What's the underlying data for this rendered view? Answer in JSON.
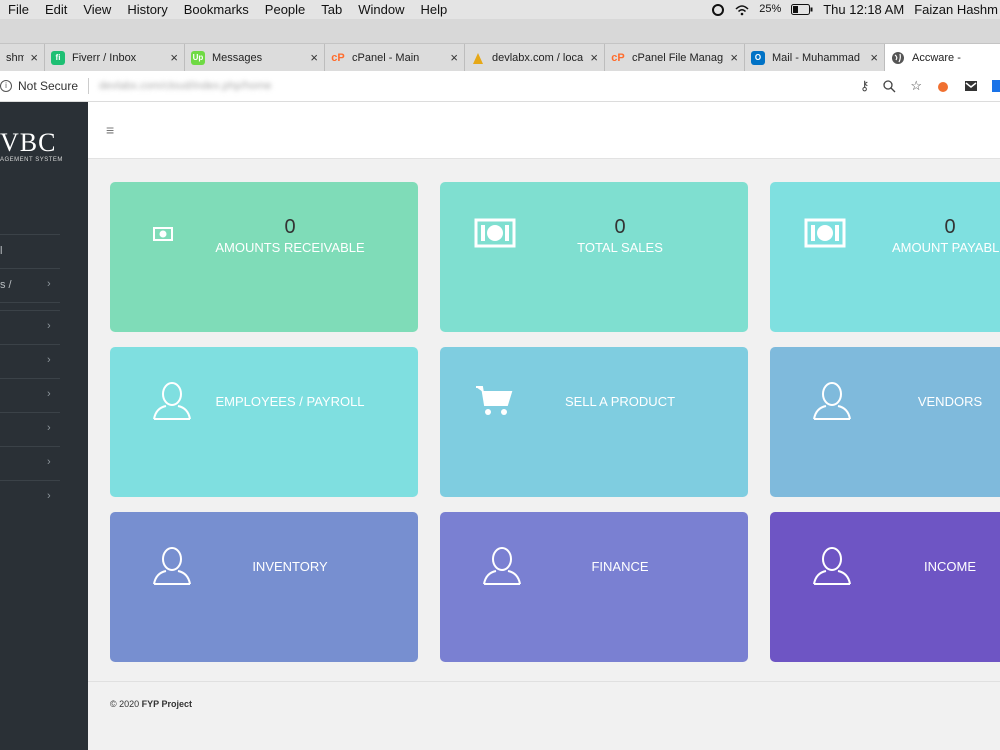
{
  "menubar": {
    "items": [
      "File",
      "Edit",
      "View",
      "History",
      "Bookmarks",
      "People",
      "Tab",
      "Window",
      "Help"
    ],
    "battery": "25%",
    "clock": "Thu 12:18 AM",
    "user": "Faizan Hashm"
  },
  "tabs": [
    {
      "label": "shmi",
      "favicon_color": "#888888"
    },
    {
      "label": "Fiverr / Inbox",
      "favicon_color": "#1dbf73"
    },
    {
      "label": "Messages",
      "favicon_color": "#6fda44"
    },
    {
      "label": "cPanel - Main",
      "favicon_color": "#ff6c2c"
    },
    {
      "label": "devlabx.com / loca",
      "favicon_color": "#e6a817"
    },
    {
      "label": "cPanel File Manag",
      "favicon_color": "#ff6c2c"
    },
    {
      "label": "Mail - Muhammad",
      "favicon_color": "#0072c6"
    },
    {
      "label": "Accware -",
      "favicon_color": "#555555",
      "active": true
    }
  ],
  "addressbar": {
    "security": "Not Secure",
    "url": "devlabx.com/cloud/index.php/home"
  },
  "sidebar": {
    "logo": "VBC",
    "logo_sub": "AGEMENT SYSTEM",
    "items": [
      {
        "label": "l",
        "chevron": false
      },
      {
        "label": "s /",
        "chevron": true
      },
      {
        "label": "",
        "chevron": true
      },
      {
        "label": "",
        "chevron": true
      },
      {
        "label": "",
        "chevron": true
      },
      {
        "label": "",
        "chevron": true
      },
      {
        "label": "",
        "chevron": true
      },
      {
        "label": "",
        "chevron": true
      }
    ]
  },
  "cards": [
    {
      "title": "AMOUNTS RECEIVABLE",
      "value": "0",
      "icon": "money-icon",
      "color": "#7fdcb8"
    },
    {
      "title": "TOTAL SALES",
      "value": "0",
      "icon": "money-icon",
      "color": "#7fdfd0"
    },
    {
      "title": "AMOUNT PAYABLE",
      "value": "0",
      "icon": "money-icon",
      "color": "#7fe0e0"
    },
    {
      "title": "EMPLOYEES / PAYROLL",
      "icon": "user-icon",
      "color": "#7fdfe0"
    },
    {
      "title": "SELL A PRODUCT",
      "icon": "cart-icon",
      "color": "#7fcde0"
    },
    {
      "title": "VENDORS",
      "icon": "user-icon",
      "color": "#7fbadc"
    },
    {
      "title": "INVENTORY",
      "icon": "user-icon",
      "color": "#778fd0"
    },
    {
      "title": "FINANCE",
      "icon": "user-icon",
      "color": "#7a80d2"
    },
    {
      "title": "INCOME",
      "icon": "user-icon",
      "color": "#6e55c4"
    }
  ],
  "footer": {
    "copyright": "© 2020",
    "project": "FYP Project"
  }
}
